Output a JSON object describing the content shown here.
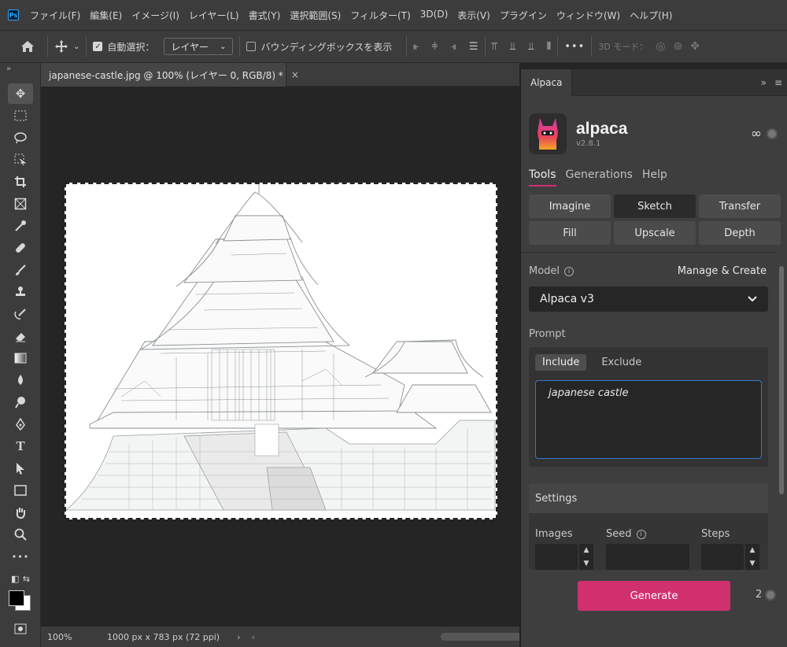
{
  "menubar": {
    "logo": "Ps",
    "items": [
      "ファイル(F)",
      "編集(E)",
      "イメージ(I)",
      "レイヤー(L)",
      "書式(Y)",
      "選択範囲(S)",
      "フィルター(T)",
      "3D(D)",
      "表示(V)",
      "プラグイン",
      "ウィンドウ(W)",
      "ヘルプ(H)"
    ]
  },
  "options": {
    "auto_select_label": "自動選択：",
    "auto_select_checked": true,
    "target_select": "レイヤー",
    "bounding_box_label": "バウンディングボックスを表示",
    "bounding_box_checked": false,
    "three_d_mode_label": "3D モード：",
    "more_label": "•••"
  },
  "document": {
    "tab_title": "japanese-castle.jpg @ 100% (レイヤー 0, RGB/8) *",
    "close_label": "×",
    "zoom": "100%",
    "info": "1000 px x 783 px (72 ppi)"
  },
  "alpaca": {
    "panel_tab": "Alpaca",
    "app_name": "alpaca",
    "version": "v2.8.1",
    "infinity": "∞",
    "nav_tabs": [
      {
        "label": "Tools",
        "active": true
      },
      {
        "label": "Generations",
        "active": false
      },
      {
        "label": "Help",
        "active": false
      }
    ],
    "tools": [
      {
        "label": "Imagine",
        "active": false
      },
      {
        "label": "Sketch",
        "active": true
      },
      {
        "label": "Transfer",
        "active": false
      },
      {
        "label": "Fill",
        "active": false
      },
      {
        "label": "Upscale",
        "active": false
      },
      {
        "label": "Depth",
        "active": false
      }
    ],
    "model_label": "Model",
    "manage_label": "Manage & Create",
    "model_value": "Alpaca v3",
    "prompt_label": "Prompt",
    "include_label": "Include",
    "exclude_label": "Exclude",
    "prompt_text": "japanese castle",
    "settings_label": "Settings",
    "images_label": "Images",
    "seed_label": "Seed",
    "steps_label": "Steps",
    "generate_label": "Generate",
    "generation_count": "2"
  },
  "colors": {
    "accent": "#d1306f",
    "focus": "#3a78c8"
  }
}
